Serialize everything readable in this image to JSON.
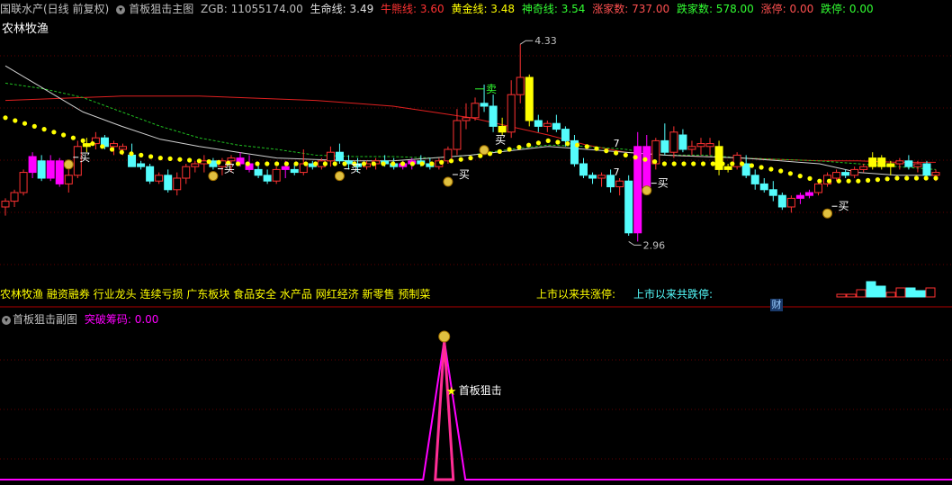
{
  "header": {
    "stock": "国联水产(日线 前复权)",
    "indicator": "首板狙击主图",
    "zgb": "ZGB: 11055174.00",
    "shengming": "生命线: 3.49",
    "niuniu": "牛熊线: 3.60",
    "huangjin": "黄金线: 3.48",
    "shenqi": "神奇线: 3.54",
    "zhangjia": "涨家数: 737.00",
    "diejia": "跌家数: 578.00",
    "zhangting": "涨停: 0.00",
    "dieting": "跌停: 0.00"
  },
  "stock_label": "农林牧渔",
  "tags": "农林牧渔 融资融券 行业龙头 连续亏损 广东板块 食品安全 水产品 网红经济 新零售 预制菜",
  "stats": {
    "up_label": "上市以来共涨停:",
    "down_label": "上市以来共跌停:"
  },
  "cai": "财",
  "sub": {
    "title": "首板狙击副图",
    "value": "突破筹码: 0.00",
    "signal_label": "首板狙击"
  },
  "colors": {
    "up": "#ff3232",
    "down": "#54fcfc",
    "magenta": "#ff00ff",
    "yellow": "#ffff00",
    "background": "#000000"
  },
  "chart_data": [
    {
      "type": "candlestick",
      "high_label": "4.33",
      "low_label": "2.96",
      "signals": {
        "buy": "买",
        "sell": "卖",
        "count": "7"
      },
      "candles": [
        [
          3.2,
          3.26,
          3.14,
          3.24
        ],
        [
          3.24,
          3.32,
          3.2,
          3.3
        ],
        [
          3.3,
          3.46,
          3.28,
          3.44
        ],
        [
          3.44,
          3.58,
          3.4,
          3.55
        ],
        [
          3.52,
          3.56,
          3.38,
          3.4
        ],
        [
          3.4,
          3.56,
          3.38,
          3.52
        ],
        [
          3.52,
          3.54,
          3.34,
          3.36
        ],
        [
          3.36,
          3.46,
          3.3,
          3.42
        ],
        [
          3.42,
          3.66,
          3.4,
          3.62
        ],
        [
          3.62,
          3.68,
          3.58,
          3.64
        ],
        [
          3.64,
          3.72,
          3.6,
          3.68
        ],
        [
          3.68,
          3.7,
          3.6,
          3.62
        ],
        [
          3.62,
          3.66,
          3.56,
          3.64
        ],
        [
          3.6,
          3.64,
          3.56,
          3.62
        ],
        [
          3.56,
          3.64,
          3.54,
          3.48
        ],
        [
          3.5,
          3.52,
          3.46,
          3.48
        ],
        [
          3.48,
          3.5,
          3.36,
          3.38
        ],
        [
          3.38,
          3.44,
          3.36,
          3.42
        ],
        [
          3.42,
          3.46,
          3.3,
          3.32
        ],
        [
          3.32,
          3.44,
          3.28,
          3.4
        ],
        [
          3.4,
          3.5,
          3.36,
          3.48
        ],
        [
          3.48,
          3.52,
          3.44,
          3.5
        ],
        [
          3.5,
          3.56,
          3.44,
          3.52
        ],
        [
          3.52,
          3.54,
          3.46,
          3.48
        ],
        [
          3.48,
          3.54,
          3.42,
          3.52
        ],
        [
          3.52,
          3.56,
          3.44,
          3.54
        ],
        [
          3.54,
          3.58,
          3.48,
          3.5
        ],
        [
          3.5,
          3.56,
          3.44,
          3.46
        ],
        [
          3.46,
          3.5,
          3.4,
          3.42
        ],
        [
          3.42,
          3.46,
          3.36,
          3.38
        ],
        [
          3.38,
          3.48,
          3.36,
          3.46
        ],
        [
          3.46,
          3.52,
          3.4,
          3.48
        ],
        [
          3.46,
          3.5,
          3.42,
          3.44
        ],
        [
          3.44,
          3.6,
          3.42,
          3.5
        ],
        [
          3.5,
          3.52,
          3.46,
          3.48
        ],
        [
          3.48,
          3.54,
          3.46,
          3.52
        ],
        [
          3.52,
          3.62,
          3.48,
          3.58
        ],
        [
          3.58,
          3.64,
          3.5,
          3.52
        ],
        [
          3.52,
          3.56,
          3.46,
          3.5
        ],
        [
          3.5,
          3.54,
          3.44,
          3.48
        ],
        [
          3.48,
          3.52,
          3.46,
          3.5
        ],
        [
          3.5,
          3.54,
          3.46,
          3.52
        ],
        [
          3.52,
          3.56,
          3.48,
          3.5
        ],
        [
          3.5,
          3.54,
          3.46,
          3.48
        ],
        [
          3.48,
          3.52,
          3.46,
          3.5
        ],
        [
          3.5,
          3.54,
          3.46,
          3.52
        ],
        [
          3.52,
          3.56,
          3.48,
          3.5
        ],
        [
          3.5,
          3.54,
          3.46,
          3.48
        ],
        [
          3.48,
          3.54,
          3.46,
          3.52
        ],
        [
          3.52,
          3.62,
          3.5,
          3.6
        ],
        [
          3.6,
          3.88,
          3.56,
          3.8
        ],
        [
          3.8,
          3.92,
          3.74,
          3.82
        ],
        [
          3.82,
          3.96,
          3.8,
          3.92
        ],
        [
          3.92,
          4.05,
          3.86,
          3.9
        ],
        [
          3.9,
          3.98,
          3.72,
          3.76
        ],
        [
          3.76,
          3.82,
          3.7,
          3.72
        ],
        [
          3.72,
          4.08,
          3.68,
          3.98
        ],
        [
          3.98,
          4.33,
          3.92,
          4.1
        ],
        [
          4.1,
          4.12,
          3.76,
          3.8
        ],
        [
          3.8,
          3.84,
          3.72,
          3.76
        ],
        [
          3.76,
          3.8,
          3.72,
          3.78
        ],
        [
          3.78,
          3.84,
          3.72,
          3.74
        ],
        [
          3.74,
          3.76,
          3.62,
          3.66
        ],
        [
          3.66,
          3.7,
          3.48,
          3.5
        ],
        [
          3.5,
          3.54,
          3.4,
          3.42
        ],
        [
          3.42,
          3.44,
          3.36,
          3.4
        ],
        [
          3.4,
          3.44,
          3.34,
          3.42
        ],
        [
          3.42,
          3.46,
          3.3,
          3.34
        ],
        [
          3.34,
          3.4,
          3.28,
          3.38
        ],
        [
          3.38,
          3.42,
          3.0,
          3.02
        ],
        [
          3.02,
          3.72,
          2.96,
          3.62
        ],
        [
          3.62,
          3.7,
          3.3,
          3.34
        ],
        [
          3.5,
          3.68,
          3.46,
          3.66
        ],
        [
          3.66,
          3.78,
          3.56,
          3.58
        ],
        [
          3.58,
          3.76,
          3.54,
          3.72
        ],
        [
          3.7,
          3.74,
          3.58,
          3.6
        ],
        [
          3.6,
          3.66,
          3.56,
          3.62
        ],
        [
          3.62,
          3.68,
          3.56,
          3.64
        ],
        [
          3.62,
          3.68,
          3.56,
          3.64
        ],
        [
          3.62,
          3.66,
          3.42,
          3.46
        ],
        [
          3.46,
          3.5,
          3.44,
          3.48
        ],
        [
          3.48,
          3.58,
          3.46,
          3.56
        ],
        [
          3.5,
          3.56,
          3.4,
          3.42
        ],
        [
          3.42,
          3.46,
          3.32,
          3.36
        ],
        [
          3.36,
          3.4,
          3.3,
          3.32
        ],
        [
          3.32,
          3.38,
          3.24,
          3.28
        ],
        [
          3.28,
          3.3,
          3.18,
          3.2
        ],
        [
          3.2,
          3.28,
          3.16,
          3.26
        ],
        [
          3.26,
          3.3,
          3.22,
          3.28
        ],
        [
          3.28,
          3.32,
          3.26,
          3.3
        ],
        [
          3.3,
          3.38,
          3.28,
          3.36
        ],
        [
          3.36,
          3.44,
          3.34,
          3.42
        ],
        [
          3.4,
          3.46,
          3.38,
          3.44
        ],
        [
          3.44,
          3.46,
          3.4,
          3.42
        ],
        [
          3.42,
          3.48,
          3.4,
          3.46
        ],
        [
          3.46,
          3.5,
          3.44,
          3.48
        ],
        [
          3.48,
          3.58,
          3.46,
          3.54
        ],
        [
          3.54,
          3.56,
          3.46,
          3.48
        ],
        [
          3.48,
          3.52,
          3.42,
          3.5
        ],
        [
          3.5,
          3.54,
          3.46,
          3.52
        ],
        [
          3.52,
          3.56,
          3.46,
          3.48
        ],
        [
          3.48,
          3.52,
          3.44,
          3.5
        ],
        [
          3.5,
          3.52,
          3.4,
          3.42
        ],
        [
          3.42,
          3.46,
          3.38,
          3.44
        ]
      ],
      "lines": {
        "red_ma": [
          3.94,
          3.95,
          3.96,
          3.97,
          3.97,
          3.97,
          3.96,
          3.95,
          3.94,
          3.92,
          3.9,
          3.86,
          3.82,
          3.76,
          3.7,
          3.63,
          3.58,
          3.56,
          3.55,
          3.54,
          3.53,
          3.52,
          3.52,
          3.51,
          3.51
        ],
        "white_ma": [
          4.18,
          4.02,
          3.86,
          3.76,
          3.67,
          3.62,
          3.58,
          3.54,
          3.53,
          3.52,
          3.52,
          3.54,
          3.56,
          3.59,
          3.62,
          3.6,
          3.58,
          3.56,
          3.55,
          3.54,
          3.52,
          3.5,
          3.44,
          3.42,
          3.42
        ],
        "green_dash": [
          4.06,
          4.02,
          3.96,
          3.86,
          3.76,
          3.68,
          3.63,
          3.6,
          3.56,
          3.55,
          3.55,
          3.54,
          3.56,
          3.6,
          3.63,
          3.62,
          3.6,
          3.56,
          3.56,
          3.54,
          3.53,
          3.52,
          3.5,
          3.48,
          3.46
        ],
        "yellow_dots": [
          3.82,
          3.74,
          3.66,
          3.58,
          3.54,
          3.52,
          3.5,
          3.5,
          3.5,
          3.5,
          3.5,
          3.5,
          3.54,
          3.6,
          3.66,
          3.62,
          3.56,
          3.5,
          3.5,
          3.5,
          3.45,
          3.38,
          3.38,
          3.4,
          3.4
        ]
      },
      "volume": [
        3,
        3,
        8,
        17,
        12,
        5,
        10,
        10,
        7,
        10
      ]
    },
    {
      "type": "line",
      "series": [
        {
          "name": "突破筹码",
          "values": [
            0,
            0,
            0,
            0,
            0,
            0,
            0,
            0,
            0,
            0,
            0,
            0,
            0,
            0,
            0,
            0,
            0,
            0,
            0,
            0,
            0,
            1,
            0,
            0,
            0,
            0,
            0,
            0,
            0,
            0,
            0,
            0,
            0,
            0,
            0,
            0,
            0,
            0,
            0,
            0,
            0,
            0,
            0,
            0,
            0,
            0
          ]
        }
      ]
    }
  ]
}
